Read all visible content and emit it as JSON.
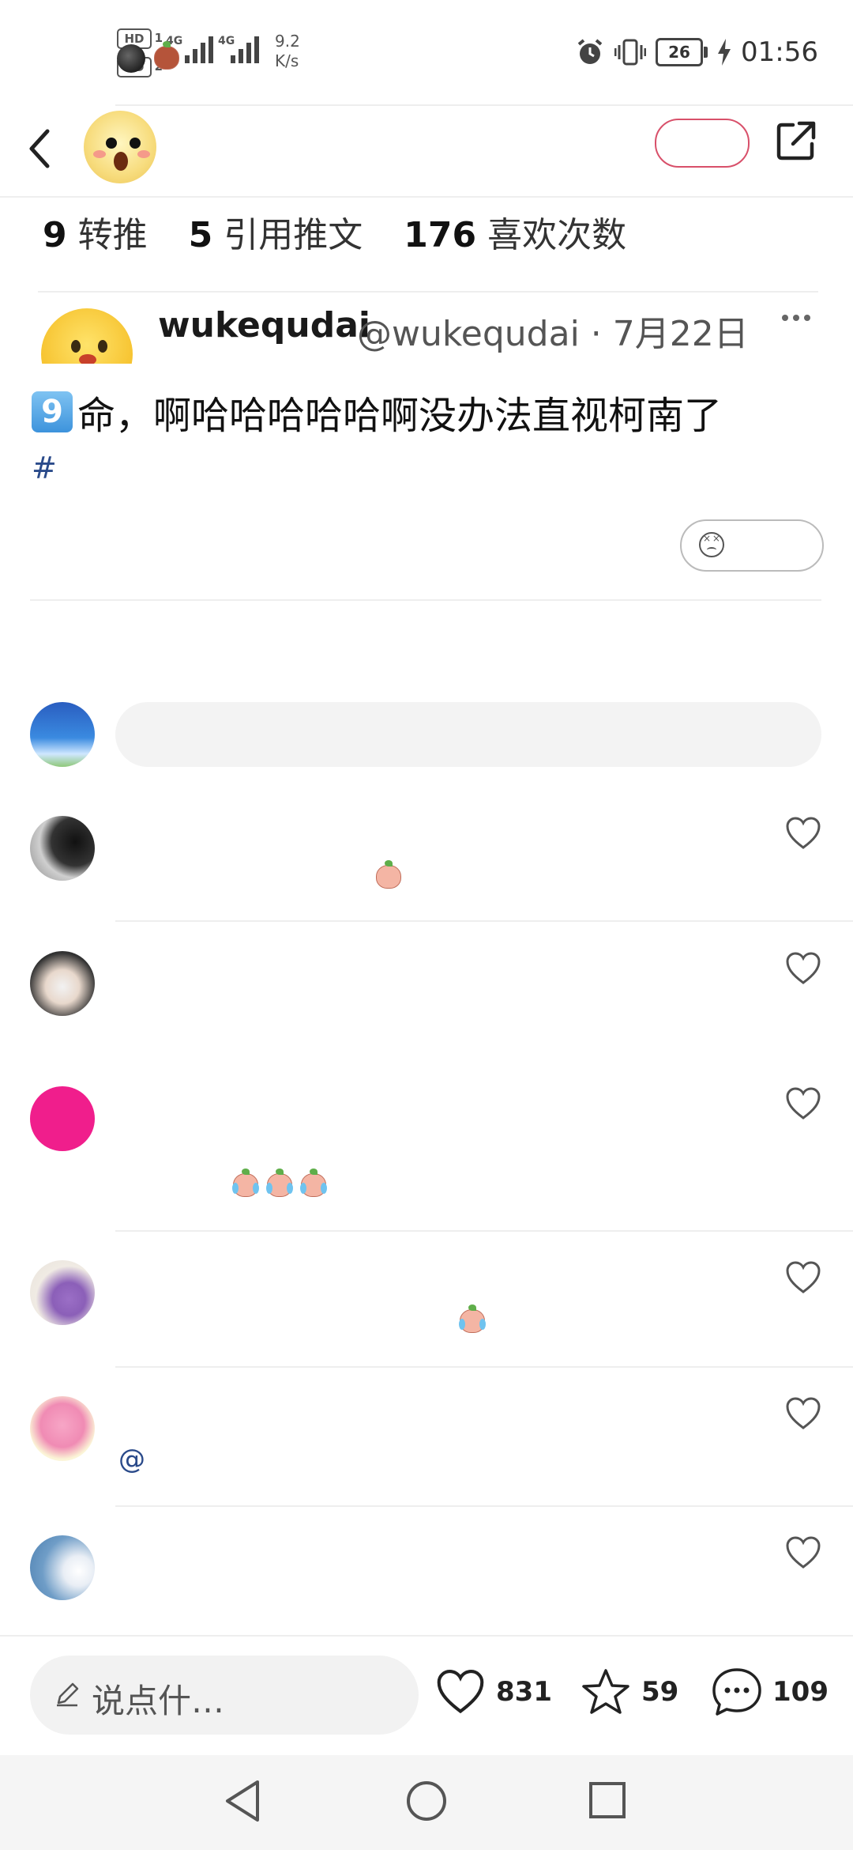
{
  "status_bar": {
    "hd1": "HD",
    "hd1_num": "1",
    "hd2": "HD",
    "hd2_num": "2",
    "net1": "4G",
    "net2": "4G",
    "speed_value": "9.2",
    "speed_unit": "K/s",
    "battery": "26",
    "time": "01:56"
  },
  "header": {
    "back_icon": "chevron-left-icon",
    "share_icon": "external-share-icon"
  },
  "stats": [
    {
      "count": "9",
      "label": "转推"
    },
    {
      "count": "5",
      "label": "引用推文"
    },
    {
      "count": "176",
      "label": "喜欢次数"
    }
  ],
  "quoted_tweet": {
    "name": "wukequdai",
    "handle_date": "@wukequdai · 7月22日",
    "keycap": "9",
    "text": "命，啊哈哈哈哈哈啊没办法直视柯南了",
    "hashtag": "#"
  },
  "comments": [
    {
      "sticker_count": 1
    },
    {
      "sticker_count": 2
    },
    {
      "sticker_count": 3
    },
    {
      "sticker_count": 1
    },
    {
      "mention": "@"
    },
    {}
  ],
  "bottom_bar": {
    "compose_placeholder": "说点什…",
    "likes": "831",
    "favorites": "59",
    "replies": "109"
  },
  "colors": {
    "accent": "#d8506a",
    "link": "#2a4a8a"
  }
}
